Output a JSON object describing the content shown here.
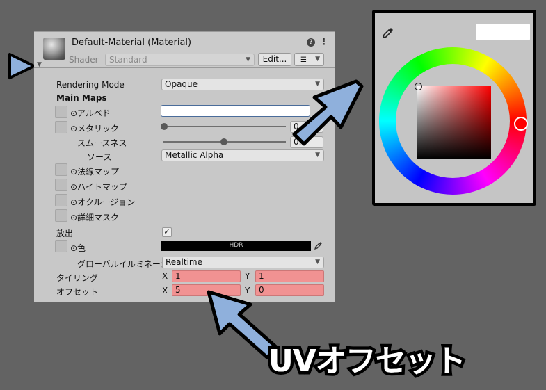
{
  "header": {
    "material_title": "Default-Material (Material)",
    "shader_label": "Shader",
    "shader_value": "Standard",
    "edit_button": "Edit...",
    "help_glyph": "?",
    "menu_glyph": "⋮",
    "list_glyph": "☰"
  },
  "properties": {
    "rendering_mode_label": "Rendering Mode",
    "rendering_mode_value": "Opaque",
    "main_maps": "Main Maps",
    "albedo": "⊙アルベド",
    "metallic": "⊙メタリック",
    "metallic_value": "0",
    "smoothness": "スムースネス",
    "smoothness_value": "0.5",
    "source": "ソース",
    "source_value": "Metallic Alpha",
    "normal_map": "⊙法線マップ",
    "height_map": "⊙ハイトマップ",
    "occlusion": "⊙オクルージョン",
    "detail_mask": "⊙詳細マスク",
    "emission": "放出",
    "emission_checked": "✓",
    "color": "⊙色",
    "hdr_label": "HDR",
    "gi_label": "グローバルイルミネーション",
    "gi_value": "Realtime",
    "tiling_label": "タイリング",
    "tiling_x": "1",
    "tiling_y": "1",
    "offset_label": "オフセット",
    "offset_x": "5",
    "offset_y": "0",
    "x_axis": "X",
    "y_axis": "Y"
  },
  "picker": {
    "selected_color": "#ff0000",
    "hex_value": ""
  },
  "annotation": {
    "caption": "UVオフセット"
  },
  "colors": {
    "panel_bg": "#c8c8c8",
    "highlight_pink": "#f19292",
    "arrow_blue": "#8fb0dc"
  },
  "icons": [
    "play-arrow-icon",
    "eyedropper-icon",
    "help-icon",
    "menu-icon",
    "list-icon",
    "checkmark-icon"
  ]
}
